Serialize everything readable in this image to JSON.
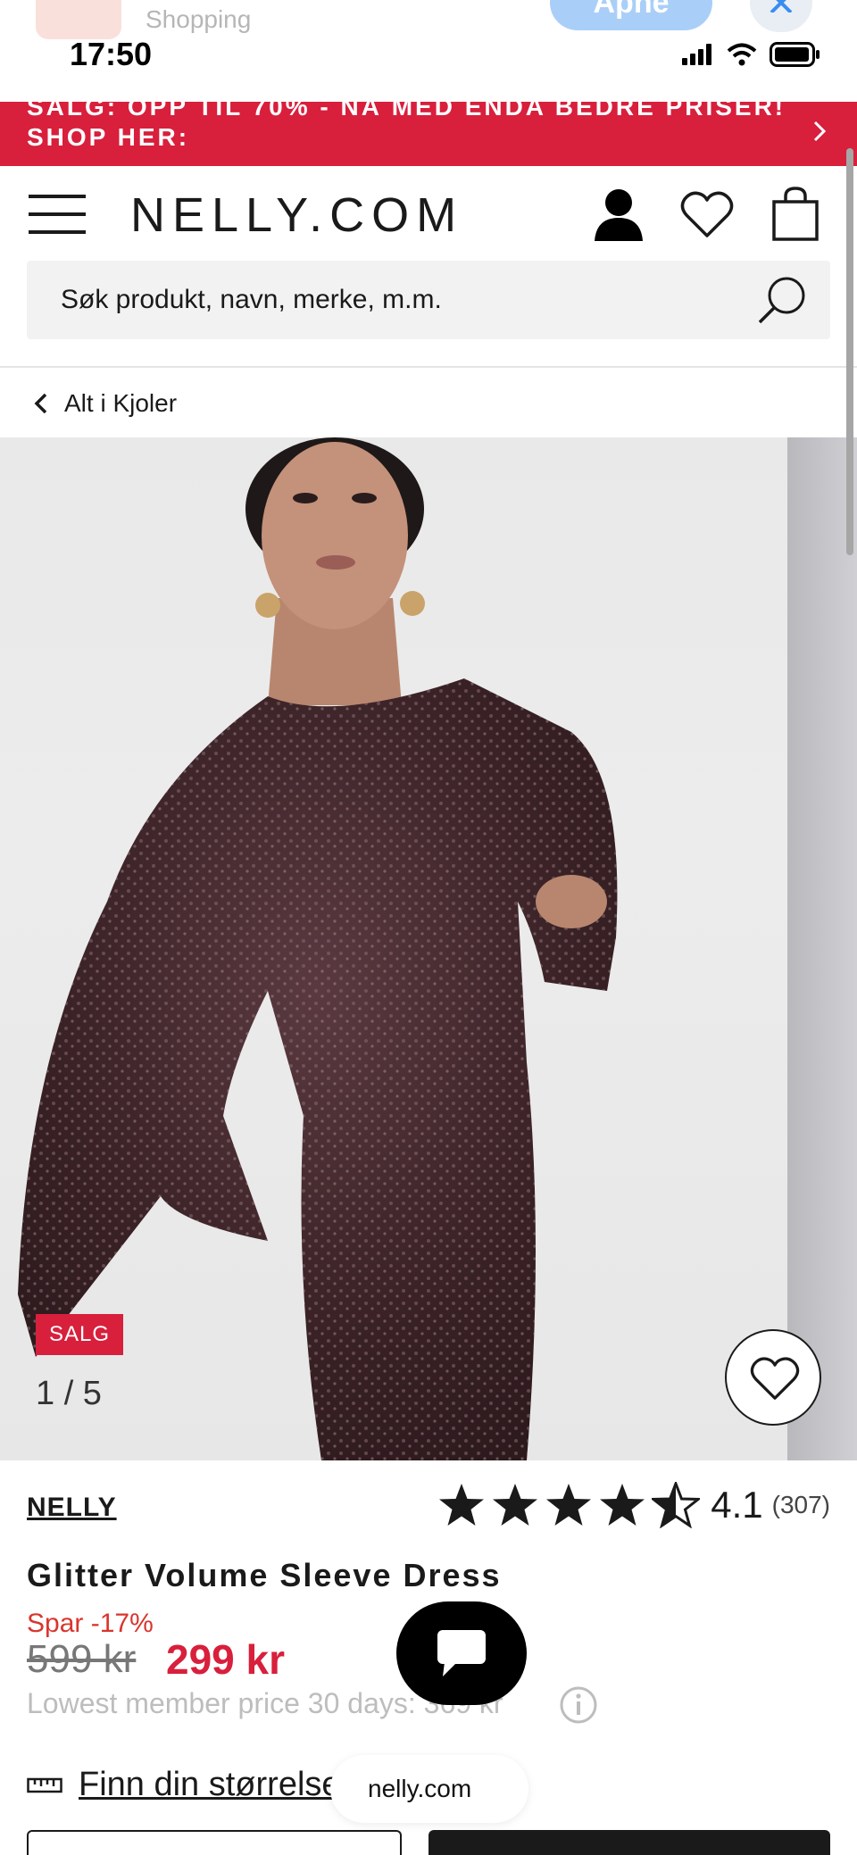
{
  "status_bar": {
    "app_subtitle": "Shopping",
    "open_button": "Åpne",
    "time": "17:50"
  },
  "promo": {
    "line1": "SALG: OPP TIL 70% - NÅ MED ENDA BEDRE PRISER!",
    "line2": "SHOP HER:"
  },
  "header": {
    "logo": "NELLY.COM"
  },
  "search": {
    "placeholder": "Søk produkt, navn, merke, m.m."
  },
  "breadcrumb": {
    "label": "Alt i Kjoler"
  },
  "gallery": {
    "badge": "SALG",
    "counter": "1 / 5"
  },
  "product": {
    "brand": "NELLY",
    "rating": "4.1",
    "rating_value": 4.1,
    "rating_count": "(307)",
    "title": "Glitter Volume Sleeve Dress",
    "discount": "Spar -17%",
    "old_price": "599 kr",
    "new_price": "299 kr",
    "member_price": "Lowest member price 30 days: 369 kr",
    "size_link": "Finn din størrelse"
  },
  "browser": {
    "url": "nelly.com"
  },
  "colors": {
    "accent_red": "#d81f3c",
    "discount_red": "#d8362e",
    "text": "#1a1a1a"
  }
}
